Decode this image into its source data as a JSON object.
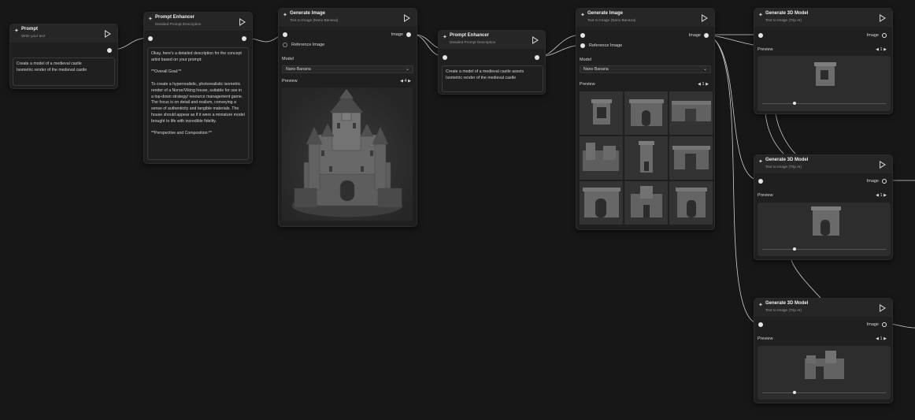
{
  "nodes": {
    "prompt": {
      "title": "Prompt",
      "subtitle": "Write your text",
      "text": "Create a model of a medieval castle\nIsometric render of the medieval castle"
    },
    "enhancer1": {
      "title": "Prompt Enhancer",
      "subtitle": "Detailed Prompt Description",
      "text": "Okay, here's a detailed description for the concept artist based on your prompt:\n\n**Overall Goal:**\n\nTo create a hyperrealistic, photorealistic isometric render of a Norse/Viking house, suitable for use in a top-down strategy/ resource management game. The focus is on detail and realism, conveying a sense of authenticity and tangible materials. The house should appear as if it were a miniature model brought to life with incredible fidelity.\n\n**Perspective and Composition:**"
    },
    "genimage1": {
      "title": "Generate Image",
      "subtitle": "Text to Image (Nano Banana)",
      "image_label": "Image",
      "reference_label": "Reference Image",
      "model_label": "Model",
      "model_value": "Nano Banana",
      "preview_label": "Preview",
      "page": "4"
    },
    "enhancer2": {
      "title": "Prompt Enhancer",
      "subtitle": "Detailed Prompt Description",
      "text": "Create a model of a medieval castle assets\nIsometric render of the medieval castle"
    },
    "genimage2": {
      "title": "Generate Image",
      "subtitle": "Text to Image (Nano Banana)",
      "image_label": "Image",
      "reference_label": "Reference Image",
      "model_label": "Model",
      "model_value": "Nano Banana",
      "preview_label": "Preview",
      "page": "1"
    },
    "gen3d1": {
      "title": "Generate 3D Model",
      "subtitle": "Text to Image (Trip AI)",
      "image_label": "Image",
      "preview_label": "Preview",
      "page": "1"
    },
    "gen3d2": {
      "title": "Generate 3D Model",
      "subtitle": "Text to Image (Trip AI)",
      "image_label": "Image",
      "preview_label": "Preview",
      "page": "1"
    },
    "gen3d3": {
      "title": "Generate 3D Model",
      "subtitle": "Text to Image (Trip AI)",
      "image_label": "Image",
      "preview_label": "Preview",
      "page": "1"
    }
  },
  "icons": {
    "node_icon": "sparkle-icon",
    "run": "play-icon",
    "prev": "triangle-left-icon",
    "next": "triangle-right-icon",
    "dropdown": "chevron-down-icon"
  },
  "colors": {
    "canvas": "#171717",
    "node": "#1f1f1f",
    "header": "#262626",
    "wire": "#d9d9d9"
  }
}
